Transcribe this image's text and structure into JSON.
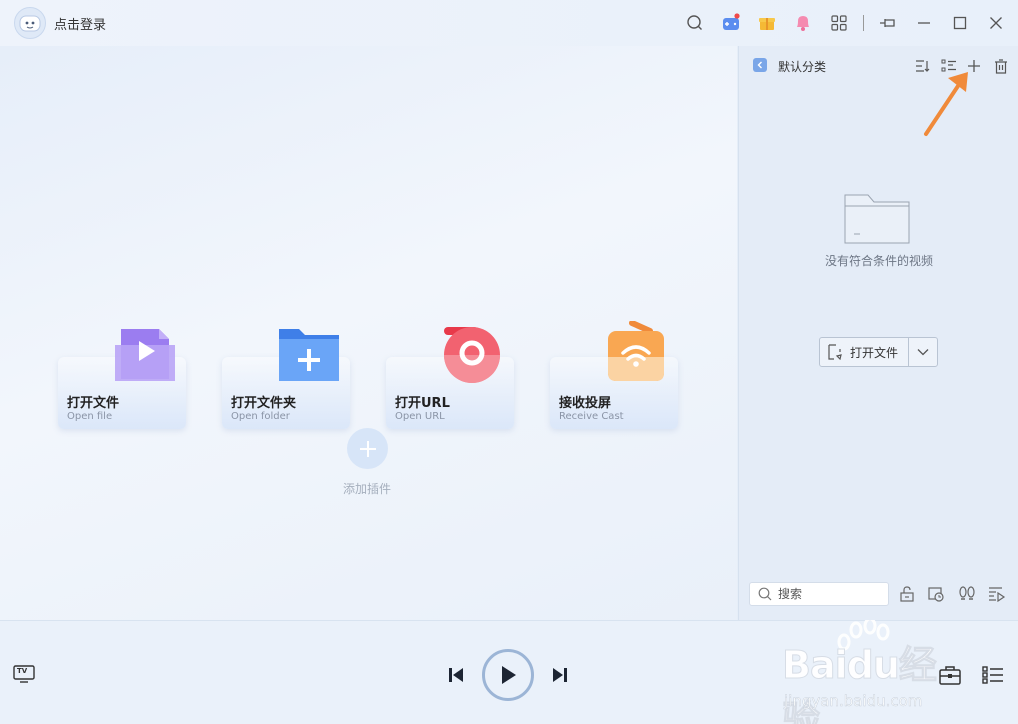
{
  "titlebar": {
    "login_label": "点击登录"
  },
  "cards": [
    {
      "title": "打开文件",
      "subtitle": "Open file",
      "icon": "play-file-icon"
    },
    {
      "title": "打开文件夹",
      "subtitle": "Open folder",
      "icon": "folder-plus-icon"
    },
    {
      "title": "打开URL",
      "subtitle": "Open URL",
      "icon": "url-record-icon"
    },
    {
      "title": "接收投屏",
      "subtitle": "Receive Cast",
      "icon": "cast-wifi-icon"
    }
  ],
  "plugin": {
    "label": "添加插件"
  },
  "sidebar": {
    "title": "默认分类",
    "empty_text": "没有符合条件的视频",
    "open_file_label": "打开文件",
    "search_placeholder": "搜索"
  },
  "bottombar": {
    "tv_label": "TV"
  },
  "watermark": {
    "brand": "Baidu经验",
    "url": "jingyan.baidu.com"
  },
  "colors": {
    "accent": "#5b8def",
    "annotation_arrow": "#f08a3a",
    "notify_dot": "#f04a4a"
  }
}
